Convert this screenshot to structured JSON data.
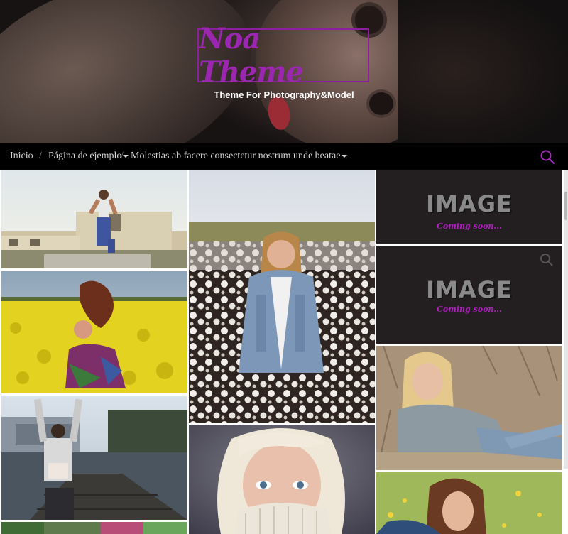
{
  "site": {
    "title": "Noa Theme",
    "tagline": "Theme For Photography&Model",
    "accent_color": "#9b27b0"
  },
  "nav": {
    "items": [
      {
        "label": "Inicio"
      },
      {
        "label": "Página de ejemplo"
      },
      {
        "label": "Molestias ab facere consectetur nostrum unde beatae"
      }
    ],
    "separator": "/",
    "search_icon": "search-icon"
  },
  "placeholder": {
    "big": "IMAGE",
    "small": "Coming soon..."
  },
  "gallery": {
    "col1": [
      "photo-woman-ruins",
      "photo-woman-yellow-field",
      "photo-woman-dock",
      "photo-graffiti"
    ],
    "col2": [
      "photo-woman-cotton-field",
      "photo-blonde-sweater"
    ],
    "col3": [
      "placeholder",
      "placeholder",
      "photo-woman-grass",
      "photo-woman-flowers"
    ]
  }
}
